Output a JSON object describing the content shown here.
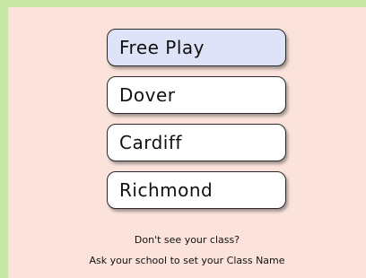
{
  "classes": [
    {
      "label": "Free Play",
      "selected": true
    },
    {
      "label": "Dover",
      "selected": false
    },
    {
      "label": "Cardiff",
      "selected": false
    },
    {
      "label": "Richmond",
      "selected": false
    }
  ],
  "help": {
    "line1": "Don't see your class?",
    "line2": "Ask your school to set your Class Name"
  },
  "colors": {
    "background_frame": "#c8e6a6",
    "panel": "#fbe3dc",
    "button": "#ffffff",
    "button_selected": "#dfe3f7"
  }
}
